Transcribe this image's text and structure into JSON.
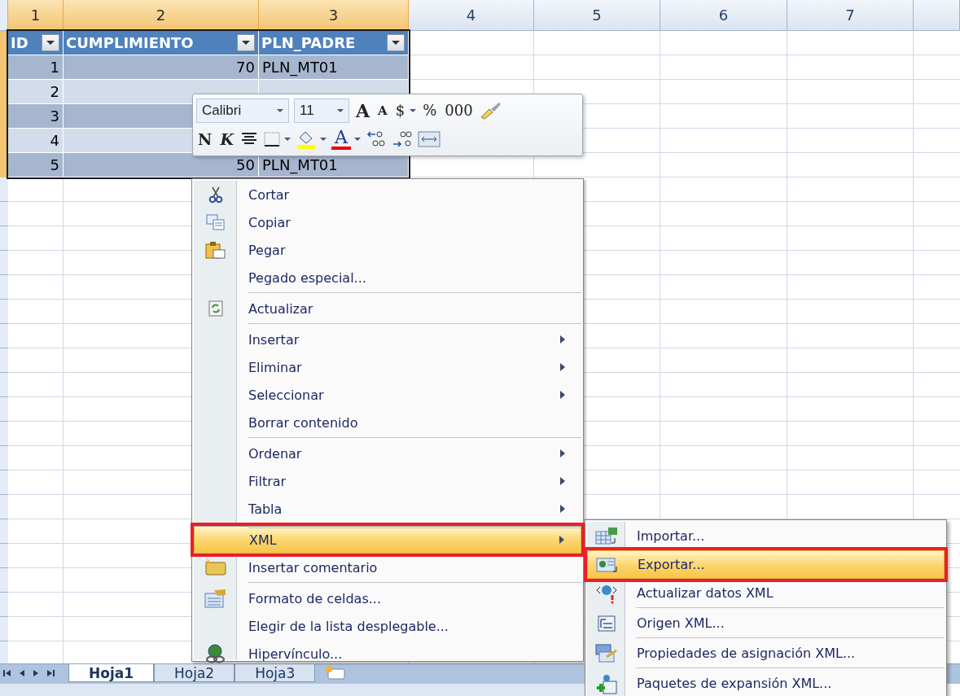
{
  "columns": [
    {
      "label": "1",
      "selected": true
    },
    {
      "label": "2",
      "selected": true
    },
    {
      "label": "3",
      "selected": true
    },
    {
      "label": "4",
      "selected": false
    },
    {
      "label": "5",
      "selected": false
    },
    {
      "label": "6",
      "selected": false
    },
    {
      "label": "7",
      "selected": false
    }
  ],
  "table": {
    "headers": [
      "ID",
      "CUMPLIMIENTO",
      "PLN_PADRE"
    ],
    "rows": [
      {
        "cells": [
          "1",
          "70",
          "PLN_MT01"
        ]
      },
      {
        "cells": [
          "2"
        ]
      },
      {
        "cells": [
          "3"
        ]
      },
      {
        "cells": [
          "4"
        ]
      },
      {
        "cells": [
          "5",
          "50",
          "PLN_MT01"
        ]
      }
    ]
  },
  "mini_toolbar": {
    "rows": [
      {
        "items": [
          {
            "kind": "combo",
            "value": "Calibri"
          },
          {
            "kind": "combo",
            "value": "11"
          },
          {
            "kind": "grow",
            "text": "A"
          },
          {
            "kind": "shrink",
            "text": "A"
          },
          {
            "kind": "glyph",
            "text": "$",
            "dropdown": true
          },
          {
            "kind": "glyph",
            "text": "%"
          },
          {
            "kind": "glyph",
            "text": "000"
          },
          {
            "kind": "brush"
          }
        ]
      },
      {
        "items": [
          {
            "kind": "bold",
            "text": "N"
          },
          {
            "kind": "italic",
            "text": "K"
          },
          {
            "kind": "align"
          },
          {
            "kind": "borders",
            "dropdown": true
          },
          {
            "kind": "fill",
            "dropdown": true
          },
          {
            "kind": "font-color",
            "text": "A",
            "dropdown": true
          },
          {
            "kind": "decimals-more"
          },
          {
            "kind": "decimals-less"
          },
          {
            "kind": "merge"
          }
        ]
      }
    ]
  },
  "menu": {
    "items": [
      {
        "label": "Cortar",
        "submenu": false,
        "separator_before": false,
        "selected": false,
        "outlined": false
      },
      {
        "label": "Copiar",
        "submenu": false,
        "separator_before": false,
        "selected": false,
        "outlined": false
      },
      {
        "label": "Pegar",
        "submenu": false,
        "separator_before": false,
        "selected": false,
        "outlined": false
      },
      {
        "label": "Pegado especial...",
        "submenu": false,
        "separator_before": false,
        "selected": false,
        "outlined": false
      },
      {
        "label": "Actualizar",
        "submenu": false,
        "separator_before": true,
        "selected": false,
        "outlined": false
      },
      {
        "label": "Insertar",
        "submenu": true,
        "separator_before": true,
        "selected": false,
        "outlined": false
      },
      {
        "label": "Eliminar",
        "submenu": true,
        "separator_before": false,
        "selected": false,
        "outlined": false
      },
      {
        "label": "Seleccionar",
        "submenu": true,
        "separator_before": false,
        "selected": false,
        "outlined": false
      },
      {
        "label": "Borrar contenido",
        "submenu": false,
        "separator_before": false,
        "selected": false,
        "outlined": false
      },
      {
        "label": "Ordenar",
        "submenu": true,
        "separator_before": true,
        "selected": false,
        "outlined": false
      },
      {
        "label": "Filtrar",
        "submenu": true,
        "separator_before": false,
        "selected": false,
        "outlined": false
      },
      {
        "label": "Tabla",
        "submenu": true,
        "separator_before": false,
        "selected": false,
        "outlined": false
      },
      {
        "label": "XML",
        "submenu": true,
        "separator_before": true,
        "selected": true,
        "outlined": true
      },
      {
        "label": "Insertar comentario",
        "submenu": false,
        "separator_before": false,
        "selected": false,
        "outlined": false
      },
      {
        "label": "Formato de celdas...",
        "submenu": false,
        "separator_before": true,
        "selected": false,
        "outlined": false
      },
      {
        "label": "Elegir de la lista desplegable...",
        "submenu": false,
        "separator_before": false,
        "selected": false,
        "outlined": false
      },
      {
        "label": "Hipervínculo...",
        "submenu": false,
        "separator_before": false,
        "selected": false,
        "outlined": false
      }
    ]
  },
  "submenu": {
    "items": [
      {
        "label": "Importar...",
        "separator_before": false,
        "selected": false,
        "outlined": false
      },
      {
        "label": "Exportar...",
        "separator_before": false,
        "selected": true,
        "outlined": true
      },
      {
        "label": "Actualizar datos XML",
        "separator_before": false,
        "selected": false,
        "outlined": false
      },
      {
        "label": "Origen XML...",
        "separator_before": true,
        "selected": false,
        "outlined": false
      },
      {
        "label": "Propiedades de asignación XML...",
        "separator_before": true,
        "selected": false,
        "outlined": false
      },
      {
        "label": "Paquetes de expansión XML...",
        "separator_before": true,
        "selected": false,
        "outlined": false
      }
    ]
  },
  "sheet_tabs": [
    {
      "label": "Hoja1",
      "selected": true
    },
    {
      "label": "Hoja2",
      "selected": false
    },
    {
      "label": "Hoja3",
      "selected": false
    }
  ]
}
